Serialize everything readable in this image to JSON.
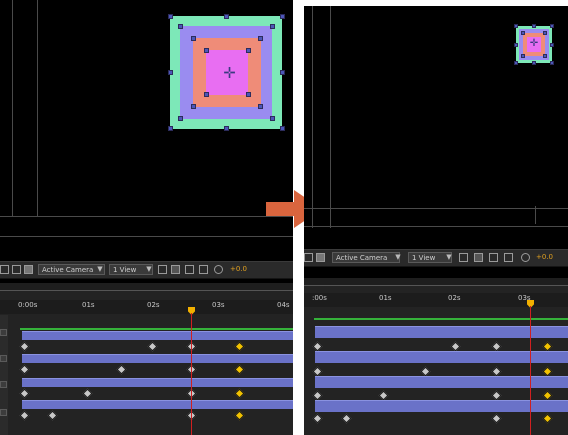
{
  "before": {
    "toolbar": {
      "camera": "Active Camera",
      "view": "1 View",
      "exposure": "+0.0"
    },
    "ruler_labels": [
      "0:00s",
      "01s",
      "02s",
      "03s",
      "04s"
    ]
  },
  "after": {
    "toolbar": {
      "camera": "Active Camera",
      "view": "1 View",
      "exposure": "+0.0"
    },
    "ruler_labels": [
      ":00s",
      "01s",
      "02s",
      "03s"
    ]
  },
  "colors": {
    "outer": "#7de8b8",
    "second": "#9a8cf0",
    "third": "#ef8c78",
    "inner": "#e86ef2",
    "arrow": "#d9653e",
    "layer_bar": "#6a72c8",
    "keyframe": "#c8c8c8",
    "keyframe_current": "#f2c200"
  },
  "icons": {
    "transition": "right-arrow-icon",
    "anchor": "crosshair-icon",
    "keyframe": "diamond-icon",
    "playhead": "current-time-indicator-icon"
  }
}
